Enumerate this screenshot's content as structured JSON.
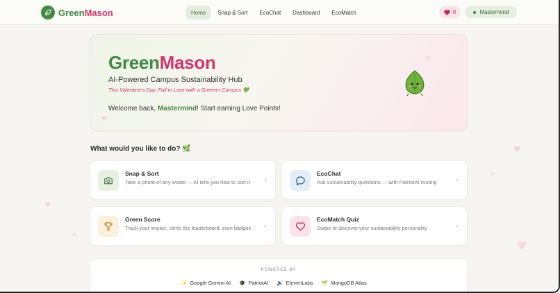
{
  "nav": {
    "brand_left": "Green",
    "brand_right": "Mason",
    "links": [
      "Home",
      "Snap & Sort",
      "EcoChat",
      "Dashboard",
      "EcoMatch"
    ],
    "love_points": "0",
    "username": "Mastermind"
  },
  "hero": {
    "title_left": "Green",
    "title_right": "Mason",
    "subtitle": "AI-Powered Campus Sustainability Hub",
    "tagline": "This Valentine's Day, Fall in Love with a Greener Campus 💚",
    "welcome_prefix": "Welcome back, ",
    "welcome_name": "Mastermind",
    "welcome_suffix": "! Start earning Love Points!"
  },
  "section_title": "What would you like to do? 🌿",
  "cards": [
    {
      "title": "Snap & Sort",
      "desc": "Take a photo of any waste — AI tells you how to sort it",
      "icon": "camera-icon"
    },
    {
      "title": "EcoChat",
      "desc": "Ask sustainability questions — with PatriotAI routing",
      "icon": "chat-bubble-icon"
    },
    {
      "title": "Green Score",
      "desc": "Track your impact, climb the leaderboard, earn badges",
      "icon": "trophy-icon"
    },
    {
      "title": "EcoMatch Quiz",
      "desc": "Swipe to discover your sustainability personality",
      "icon": "heart-icon"
    }
  ],
  "powered": {
    "label": "POWERED BY",
    "partners": [
      {
        "icon": "✨",
        "name": "Google Gemini AI"
      },
      {
        "icon": "🎓",
        "name": "PatriotAI"
      },
      {
        "icon": "🔊",
        "name": "ElevenLabs"
      },
      {
        "icon": "🌱",
        "name": "MongoDB Atlas"
      }
    ]
  },
  "colors": {
    "green": "#3f8a3f",
    "pink": "#d6336c",
    "background": "#f6f5f1"
  }
}
